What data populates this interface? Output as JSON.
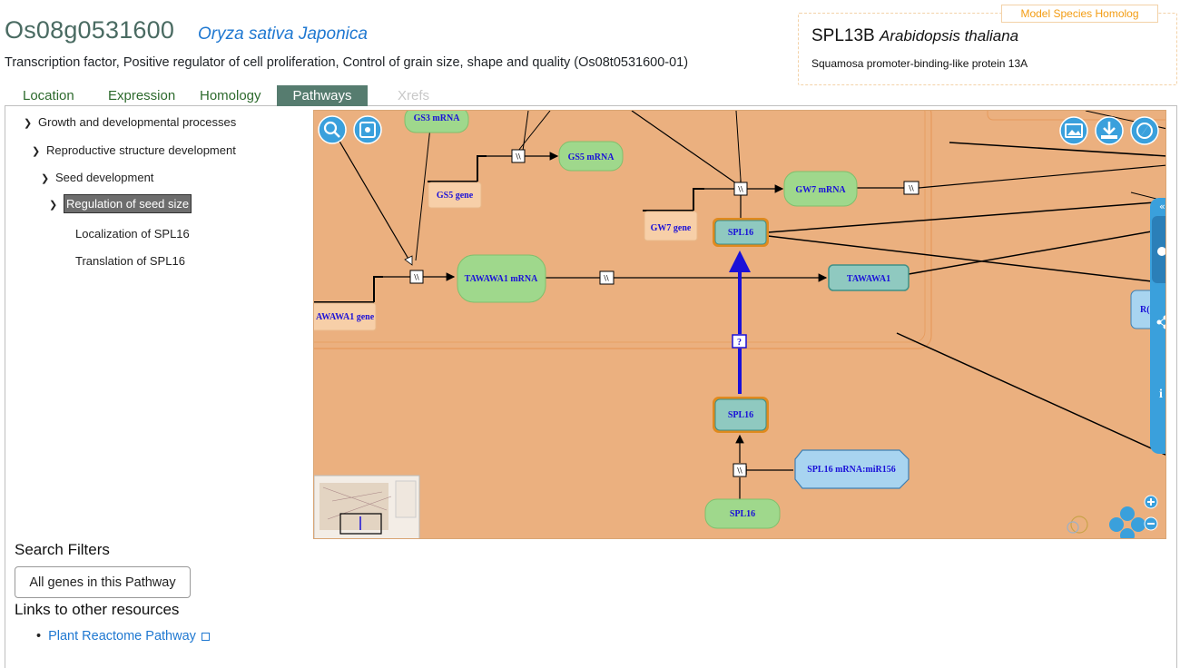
{
  "header": {
    "gene_id": "Os08g0531600",
    "species": "Oryza sativa Japonica",
    "description": "Transcription factor, Positive regulator of cell proliferation, Control of grain size, shape and quality (Os08t0531600-01)"
  },
  "homolog": {
    "tag": "Model Species Homolog",
    "name": "SPL13B",
    "species": "Arabidopsis thaliana",
    "description": "Squamosa promoter-binding-like protein 13A"
  },
  "tabs": [
    {
      "label": "Location",
      "state": "normal"
    },
    {
      "label": "Expression",
      "state": "normal"
    },
    {
      "label": "Homology",
      "state": "normal"
    },
    {
      "label": "Pathways",
      "state": "active"
    },
    {
      "label": "Xrefs",
      "state": "disabled"
    }
  ],
  "tree": [
    {
      "label": "Growth and developmental processes",
      "expanded": true
    },
    {
      "label": "Reproductive structure development",
      "expanded": true
    },
    {
      "label": "Seed development",
      "expanded": true
    },
    {
      "label": "Regulation of seed size",
      "expanded": true,
      "selected": true
    },
    {
      "label": "Localization of SPL16"
    },
    {
      "label": "Translation of SPL16"
    }
  ],
  "diagram": {
    "background": "#ebb07f",
    "nodes": {
      "gs3_mrna": "GS3 mRNA",
      "gs5_mrna": "GS5 mRNA",
      "gs5_gene": "GS5 gene",
      "gw7_mrna": "GW7 mRNA",
      "gw7_gene": "GW7 gene",
      "spl16_top": "SPL16",
      "tawawa1_mrna": "TAWAWA1 mRNA",
      "tawawa1_gene": "AWAWA1 gene",
      "tawawa1": "TAWAWA1",
      "spl16_mid": "SPL16",
      "spl16_mirna": "SPL16 mRNA:miR156",
      "spl16_bottom": "SPL16",
      "rc_partial": "R("
    },
    "question_mark": "?",
    "transition_symbol": "\\\\",
    "toolbar_icons": [
      "search-icon",
      "fit-screen-icon",
      "image-export-icon",
      "download-icon",
      "compass-icon"
    ],
    "side_icons": [
      "collapse-icon",
      "hierarchy-icon",
      "share-icon",
      "info-icon"
    ],
    "colors": {
      "gene": "#f7cfa8",
      "mrna": "#9fd88c",
      "protein": "#8fc9c0",
      "complex": "#a8d4f0",
      "selected_border": "#e08a1e",
      "reaction": "#1a10d8"
    }
  },
  "filters": {
    "title": "Search Filters",
    "button_label": "All genes in this Pathway"
  },
  "links": {
    "title": "Links to other resources",
    "items": [
      {
        "label": "Plant Reactome Pathway"
      }
    ]
  }
}
